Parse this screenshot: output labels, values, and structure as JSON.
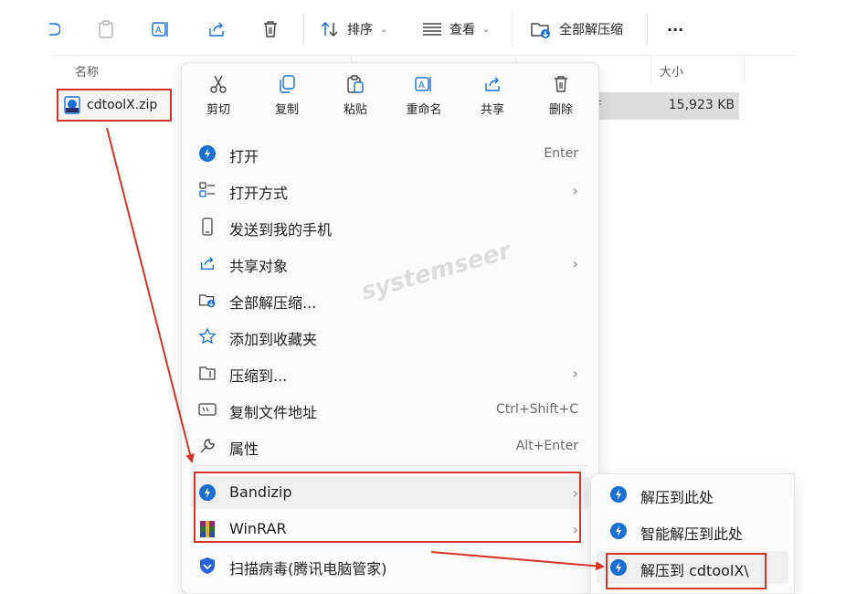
{
  "toolbar": {
    "sort_label": "排序",
    "view_label": "查看",
    "extract_all_label": "全部解压缩",
    "more_label": "···"
  },
  "columns": {
    "name": "名称",
    "size": "大小"
  },
  "file": {
    "name": "cdtoolX.zip",
    "size": "15,923 KB",
    "partial_type": "F"
  },
  "quick_actions": [
    {
      "icon": "cut-icon",
      "label": "剪切"
    },
    {
      "icon": "copy-icon",
      "label": "复制"
    },
    {
      "icon": "paste-icon",
      "label": "粘贴"
    },
    {
      "icon": "rename-icon",
      "label": "重命名"
    },
    {
      "icon": "share-icon",
      "label": "共享"
    },
    {
      "icon": "delete-icon",
      "label": "删除"
    }
  ],
  "menu_items": [
    {
      "icon": "bandizip-icon",
      "label": "打开",
      "shortcut": "Enter"
    },
    {
      "icon": "open-with-icon",
      "label": "打开方式",
      "submenu": true
    },
    {
      "icon": "phone-icon",
      "label": "发送到我的手机"
    },
    {
      "icon": "share-icon",
      "label": "共享对象",
      "submenu": true
    },
    {
      "icon": "extract-folder-icon",
      "label": "全部解压缩..."
    },
    {
      "icon": "star-icon",
      "label": "添加到收藏夹"
    },
    {
      "icon": "compress-icon",
      "label": "压缩到...",
      "submenu": true
    },
    {
      "icon": "copy-path-icon",
      "label": "复制文件地址",
      "shortcut": "Ctrl+Shift+C"
    },
    {
      "icon": "wrench-icon",
      "label": "属性",
      "shortcut": "Alt+Enter"
    },
    {
      "icon": "bandizip-icon",
      "label": "Bandizip",
      "submenu": true
    },
    {
      "icon": "winrar-icon",
      "label": "WinRAR",
      "submenu": true
    },
    {
      "icon": "tencent-shield-icon",
      "label": "扫描病毒(腾讯电脑管家)"
    }
  ],
  "submenu_items": [
    {
      "icon": "bandizip-icon",
      "label": "解压到此处"
    },
    {
      "icon": "bandizip-icon",
      "label": "智能解压到此处"
    },
    {
      "icon": "bandizip-icon",
      "label": "解压到 cdtoolX\\"
    }
  ],
  "chevron": "›",
  "watermark": "systemseer",
  "colors": {
    "accent": "#1a6fd1",
    "highlight_box": "#d5342c",
    "arrow": "#d5342c"
  }
}
